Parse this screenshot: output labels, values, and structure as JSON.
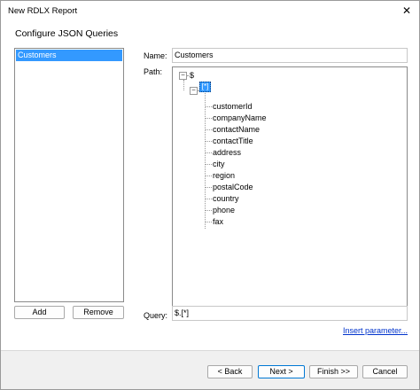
{
  "window": {
    "title": "New RDLX Report",
    "close_glyph": "✕"
  },
  "page": {
    "heading": "Configure JSON Queries"
  },
  "queries": {
    "items": [
      "Customers"
    ],
    "add_label": "Add",
    "remove_label": "Remove"
  },
  "form": {
    "name_label": "Name:",
    "name_value": "Customers",
    "path_label": "Path:",
    "query_label": "Query:",
    "query_value": "$.[*]",
    "insert_parameter_label": "Insert parameter..."
  },
  "tree": {
    "root": "$",
    "root_toggle": "−",
    "array_node": "[*]",
    "array_toggle": "−",
    "fields": [
      "customerId",
      "companyName",
      "contactName",
      "contactTitle",
      "address",
      "city",
      "region",
      "postalCode",
      "country",
      "phone",
      "fax"
    ]
  },
  "footer": {
    "back_label": "< Back",
    "next_label": "Next >",
    "finish_label": "Finish >>",
    "cancel_label": "Cancel"
  }
}
